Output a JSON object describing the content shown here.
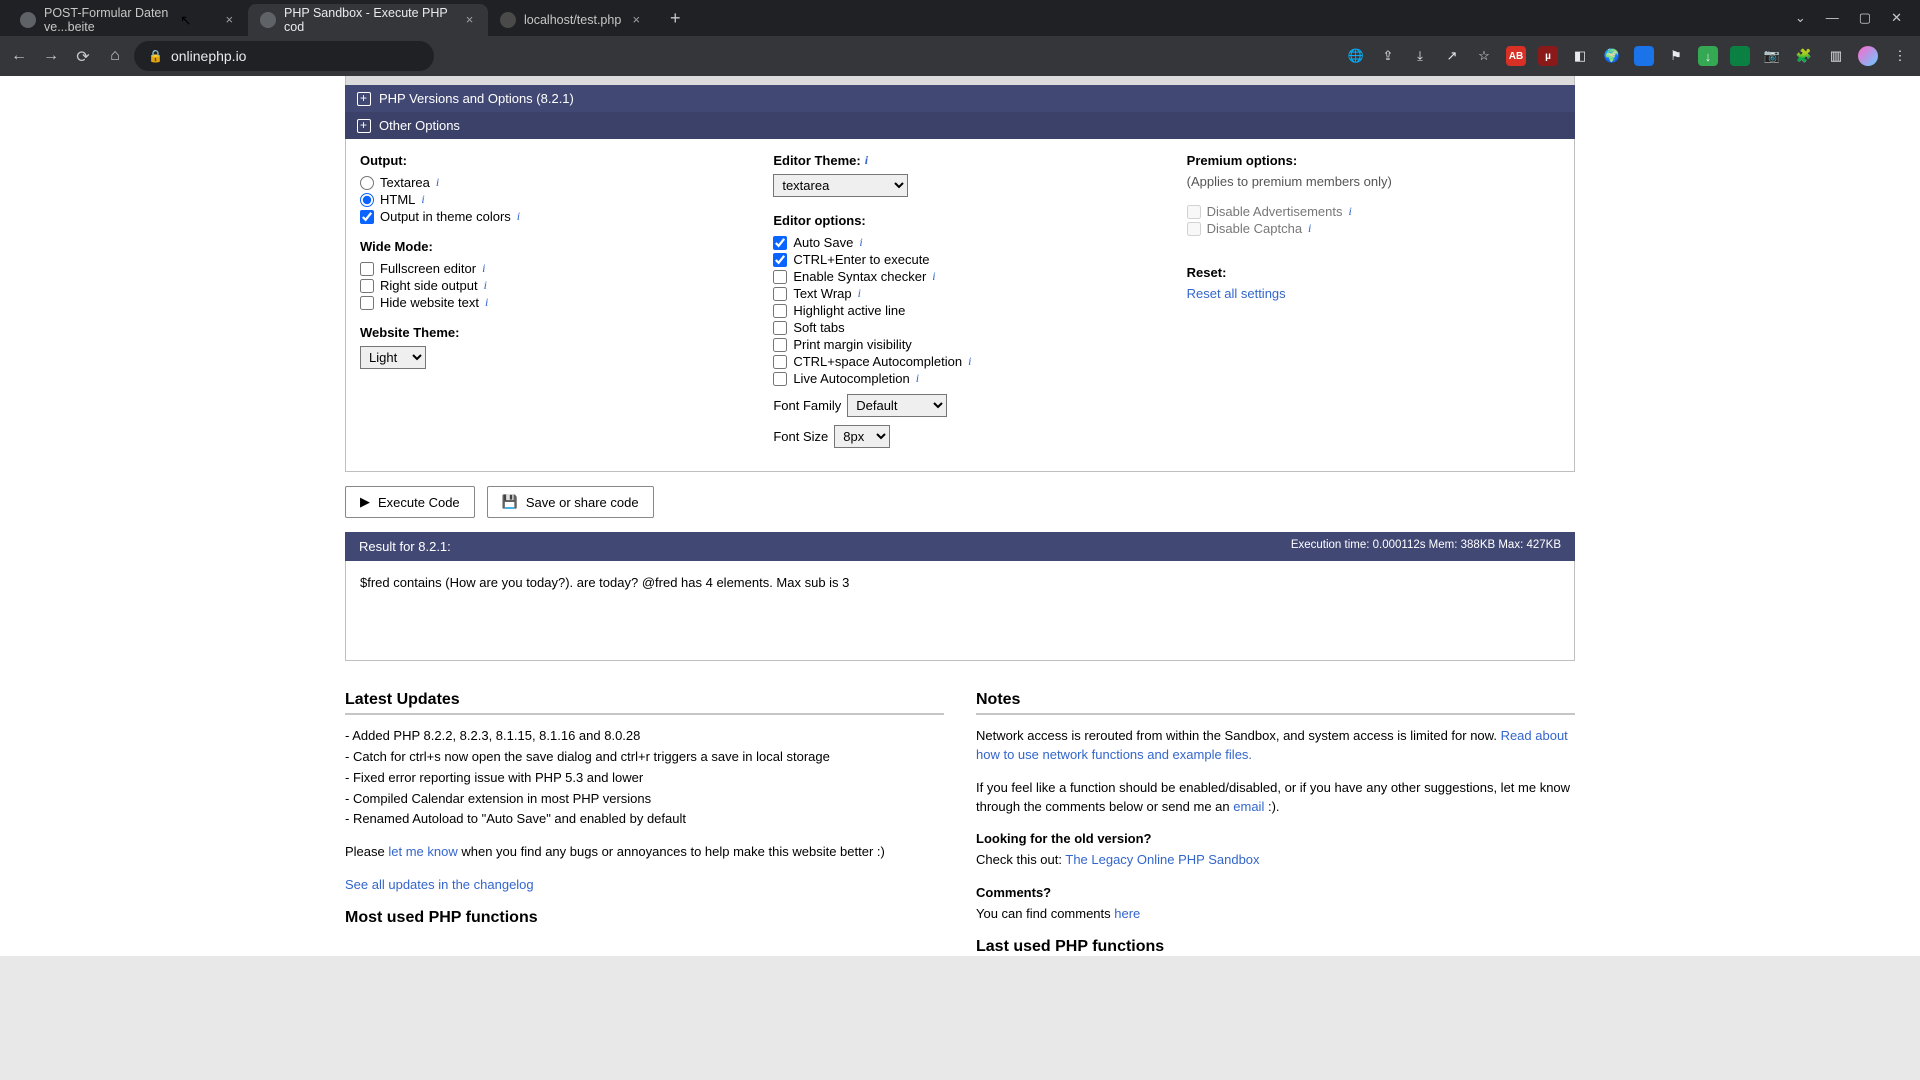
{
  "browser": {
    "tabs": [
      {
        "title": "POST-Formular Daten ve...beite",
        "active": false
      },
      {
        "title": "PHP Sandbox - Execute PHP cod",
        "active": true
      },
      {
        "title": "localhost/test.php",
        "active": false
      }
    ],
    "url": "onlinephp.io",
    "win": {
      "chevron": "⌄",
      "min": "—",
      "max": "▢",
      "close": "✕"
    }
  },
  "accordions": {
    "versions": "PHP Versions and Options (8.2.1)",
    "other": "Other Options"
  },
  "options": {
    "output": {
      "title": "Output:",
      "textarea": "Textarea",
      "html": "HTML",
      "themecolors": "Output in theme colors"
    },
    "wide": {
      "title": "Wide Mode:",
      "fullscreen": "Fullscreen editor",
      "rightside": "Right side output",
      "hidetext": "Hide website text"
    },
    "website_theme": {
      "title": "Website Theme:",
      "value": "Light"
    },
    "editor_theme": {
      "title": "Editor Theme:",
      "value": "textarea"
    },
    "editor_opts": {
      "title": "Editor options:",
      "autosave": "Auto Save",
      "ctrlenter": "CTRL+Enter to execute",
      "syntax": "Enable Syntax checker",
      "textwrap": "Text Wrap",
      "highlight": "Highlight active line",
      "softtabs": "Soft tabs",
      "printmargin": "Print margin visibility",
      "ctrlspace": "CTRL+space Autocompletion",
      "liveauto": "Live Autocompletion"
    },
    "font_family": {
      "label": "Font Family",
      "value": "Default"
    },
    "font_size": {
      "label": "Font Size",
      "value": "8px"
    },
    "premium": {
      "title": "Premium options:",
      "note": "(Applies to premium members only)",
      "ads": "Disable Advertisements",
      "captcha": "Disable Captcha"
    },
    "reset": {
      "title": "Reset:",
      "link": "Reset all settings"
    }
  },
  "buttons": {
    "execute": "Execute Code",
    "save": "Save or share code"
  },
  "result": {
    "title": "Result for 8.2.1:",
    "meta": "Execution time: 0.000112s Mem: 388KB Max: 427KB",
    "body": "$fred contains (How are you today?). are today? @fred has 4 elements. Max sub is 3"
  },
  "bottom": {
    "updates": {
      "title": "Latest Updates",
      "l1": "- Added PHP 8.2.2, 8.2.3, 8.1.15, 8.1.16 and 8.0.28",
      "l2": "- Catch for ctrl+s now open the save dialog and ctrl+r triggers a save in local storage",
      "l3": "- Fixed error reporting issue with PHP 5.3 and lower",
      "l4": "- Compiled Calendar extension in most PHP versions",
      "l5": "- Renamed Autoload to \"Auto Save\" and enabled by default",
      "bugs_pre": "Please ",
      "bugs_link": "let me know",
      "bugs_post": " when you find any bugs or annoyances to help make this website better :)",
      "changelog": "See all updates in the changelog"
    },
    "notes": {
      "title": "Notes",
      "p1_pre": "Network access is rerouted from within the Sandbox, and system access is limited for now. ",
      "p1_link": "Read about how to use network functions and example files.",
      "p2_pre": "If you feel like a function should be enabled/disabled, or if you have any other suggestions, let me know through the comments below or send me an ",
      "p2_link": "email",
      "p2_post": " :).",
      "old_title": "Looking for the old version?",
      "old_pre": "Check this out: ",
      "old_link": "The Legacy Online PHP Sandbox",
      "comments_title": "Comments?",
      "comments_text": "You can find comments ",
      "comments_link": "here"
    },
    "cutoff_left": "Most used PHP functions",
    "cutoff_right": "Last used PHP functions"
  }
}
